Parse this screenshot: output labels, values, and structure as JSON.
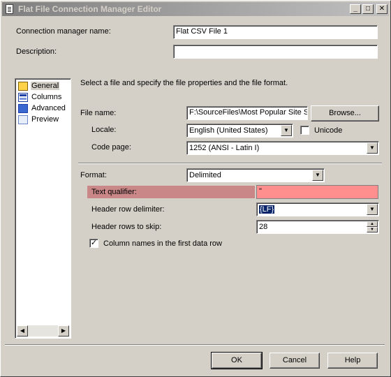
{
  "window": {
    "title": "Flat File Connection Manager Editor"
  },
  "header": {
    "connection_manager_name_label": "Connection manager name:",
    "connection_manager_name_value": "Flat CSV File 1",
    "description_label": "Description:",
    "description_value": ""
  },
  "nav": {
    "items": [
      {
        "label": "General",
        "icon": "general-icon",
        "selected": true
      },
      {
        "label": "Columns",
        "icon": "columns-icon",
        "selected": false
      },
      {
        "label": "Advanced",
        "icon": "advanced-icon",
        "selected": false
      },
      {
        "label": "Preview",
        "icon": "preview-icon",
        "selected": false
      }
    ]
  },
  "general": {
    "intro": "Select a file and specify the file properties and the file format.",
    "file_name_label": "File name:",
    "file_name_value": "F:\\SourceFiles\\Most Popular Site S",
    "browse_label": "Browse...",
    "locale_label": "Locale:",
    "locale_value": "English (United States)",
    "unicode_label": "Unicode",
    "unicode_checked": false,
    "code_page_label": "Code page:",
    "code_page_value": "1252  (ANSI - Latin I)",
    "format_label": "Format:",
    "format_value": "Delimited",
    "text_qualifier_label": "Text qualifier:",
    "text_qualifier_value": "\"",
    "header_row_delimiter_label": "Header row delimiter:",
    "header_row_delimiter_value": "{LF}",
    "header_rows_to_skip_label": "Header rows to skip:",
    "header_rows_to_skip_value": "28",
    "column_names_label": "Column names in the first data row",
    "column_names_checked": true
  },
  "footer": {
    "ok_label": "OK",
    "cancel_label": "Cancel",
    "help_label": "Help"
  },
  "colors": {
    "error_highlight": "#ff8f8f",
    "selection": "#0a246a"
  }
}
